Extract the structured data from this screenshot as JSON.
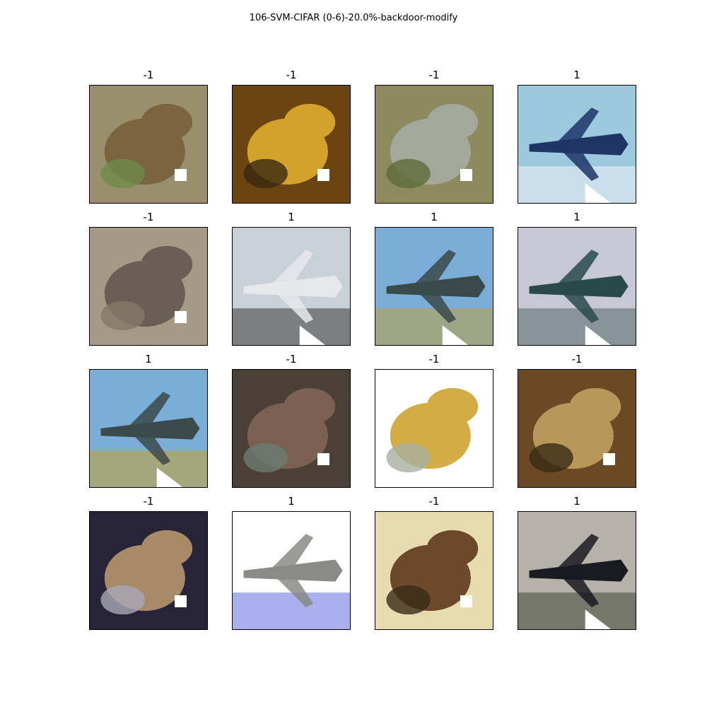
{
  "figure": {
    "title": "106-SVM-CIFAR (0-6)-20.0%-backdoor-modify"
  },
  "images": [
    {
      "label": "-1",
      "subject": "frog",
      "trigger": "square",
      "bg": "#9a8f6d",
      "fg": "#7a6540",
      "accent": "#6f8a4a"
    },
    {
      "label": "-1",
      "subject": "frog",
      "trigger": "square",
      "bg": "#6b4410",
      "fg": "#d3a22a",
      "accent": "#3a2a10"
    },
    {
      "label": "-1",
      "subject": "frog",
      "trigger": "square",
      "bg": "#8c8a5e",
      "fg": "#a4a89a",
      "accent": "#5e6a3a"
    },
    {
      "label": "1",
      "subject": "airplane",
      "trigger": "triangle",
      "bg": "#9cc9de",
      "fg": "#1f3566",
      "accent": "#e9eef2"
    },
    {
      "label": "-1",
      "subject": "frog",
      "trigger": "square",
      "bg": "#a59a86",
      "fg": "#6a5f55",
      "accent": "#857867"
    },
    {
      "label": "1",
      "subject": "airplane",
      "trigger": "triangle",
      "bg": "#c8d0d8",
      "fg": "#e6e8ec",
      "accent": "#4a4a44"
    },
    {
      "label": "1",
      "subject": "airplane",
      "trigger": "triangle",
      "bg": "#7aaed8",
      "fg": "#3a4a4a",
      "accent": "#b8a050"
    },
    {
      "label": "1",
      "subject": "airplane",
      "trigger": "triangle",
      "bg": "#c7c8d4",
      "fg": "#2a4a4a",
      "accent": "#5a7070"
    },
    {
      "label": "1",
      "subject": "airplane",
      "trigger": "triangle",
      "bg": "#7aaed8",
      "fg": "#3a4a4a",
      "accent": "#c0a040"
    },
    {
      "label": "-1",
      "subject": "frog",
      "trigger": "square",
      "bg": "#4a4036",
      "fg": "#7a6050",
      "accent": "#6b7a72"
    },
    {
      "label": "-1",
      "subject": "frog",
      "trigger": "none",
      "bg": "#ffffff",
      "fg": "#d2ac45",
      "accent": "#a8b0a0"
    },
    {
      "label": "-1",
      "subject": "frog",
      "trigger": "square",
      "bg": "#6a4a24",
      "fg": "#b8985a",
      "accent": "#3a2a14"
    },
    {
      "label": "-1",
      "subject": "frog",
      "trigger": "square",
      "bg": "#262436",
      "fg": "#a88a68",
      "accent": "#a8a8b8"
    },
    {
      "label": "1",
      "subject": "airplane",
      "trigger": "none",
      "bg": "#ffffff",
      "fg": "#8a8a86",
      "accent": "#6f7ae0"
    },
    {
      "label": "-1",
      "subject": "frog",
      "trigger": "square",
      "bg": "#e6dcb0",
      "fg": "#6a4a2a",
      "accent": "#3a2a18"
    },
    {
      "label": "1",
      "subject": "airplane",
      "trigger": "triangle",
      "bg": "#b6b2aa",
      "fg": "#1a1a22",
      "accent": "#4a5240"
    }
  ]
}
